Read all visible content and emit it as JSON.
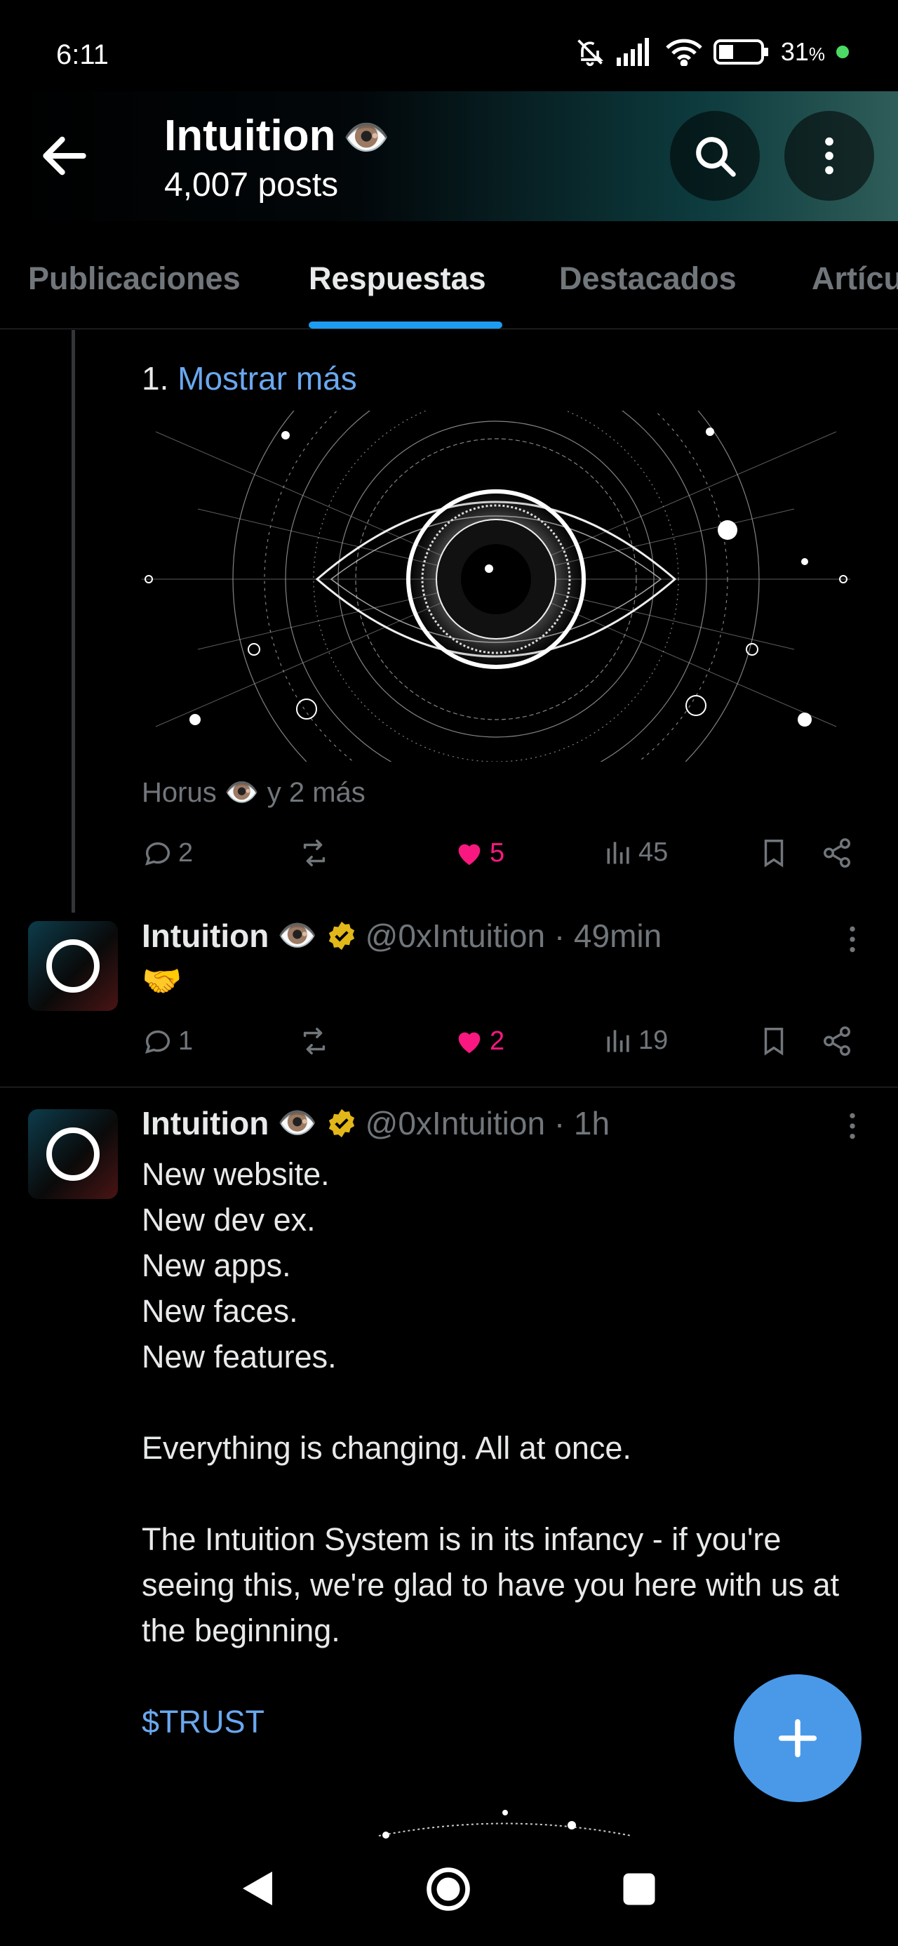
{
  "status_bar": {
    "time": "6:11",
    "battery": "31",
    "battery_unit": "%"
  },
  "header": {
    "title": "Intuition",
    "title_emoji": "👁️",
    "posts_count": "4,007 posts"
  },
  "tabs": [
    {
      "label": "Publicaciones",
      "active": false
    },
    {
      "label": "Respuestas",
      "active": true
    },
    {
      "label": "Destacados",
      "active": false
    },
    {
      "label": "Artícu",
      "active": false
    }
  ],
  "thread_post": {
    "show_more_prefix": "1.",
    "show_more_link": "Mostrar más",
    "tagged": "Horus 👁️ y 2 más",
    "replies": "2",
    "likes": "5",
    "views": "45"
  },
  "reply_post": {
    "name": "Intuition",
    "name_emoji": "👁️",
    "meta": "@0xIntuition · 49min",
    "text": "🤝",
    "replies": "1",
    "likes": "2",
    "views": "19"
  },
  "main_post": {
    "name": "Intuition",
    "name_emoji": "👁️",
    "meta": "@0xIntuition · 1h",
    "lines": [
      "New website.",
      "New dev ex.",
      "New apps.",
      "New faces.",
      "New features."
    ],
    "paragraph2": "Everything is changing. All at once.",
    "paragraph3": "The Intuition System is in its infancy - if you're seeing this, we're glad to have you here with us at the beginning.",
    "cashtag": "$TRUST"
  },
  "icons": {
    "back": "arrow-left-icon",
    "search": "search-icon",
    "more": "more-vertical-icon",
    "reply": "comment-icon",
    "repost": "repost-icon",
    "like": "heart-icon",
    "views": "views-icon",
    "bookmark": "bookmark-icon",
    "share": "share-icon",
    "compose": "plus-icon"
  },
  "colors": {
    "accent": "#1d9bf0",
    "like": "#f91880",
    "verified": "#e2b719",
    "muted": "#71767b"
  }
}
